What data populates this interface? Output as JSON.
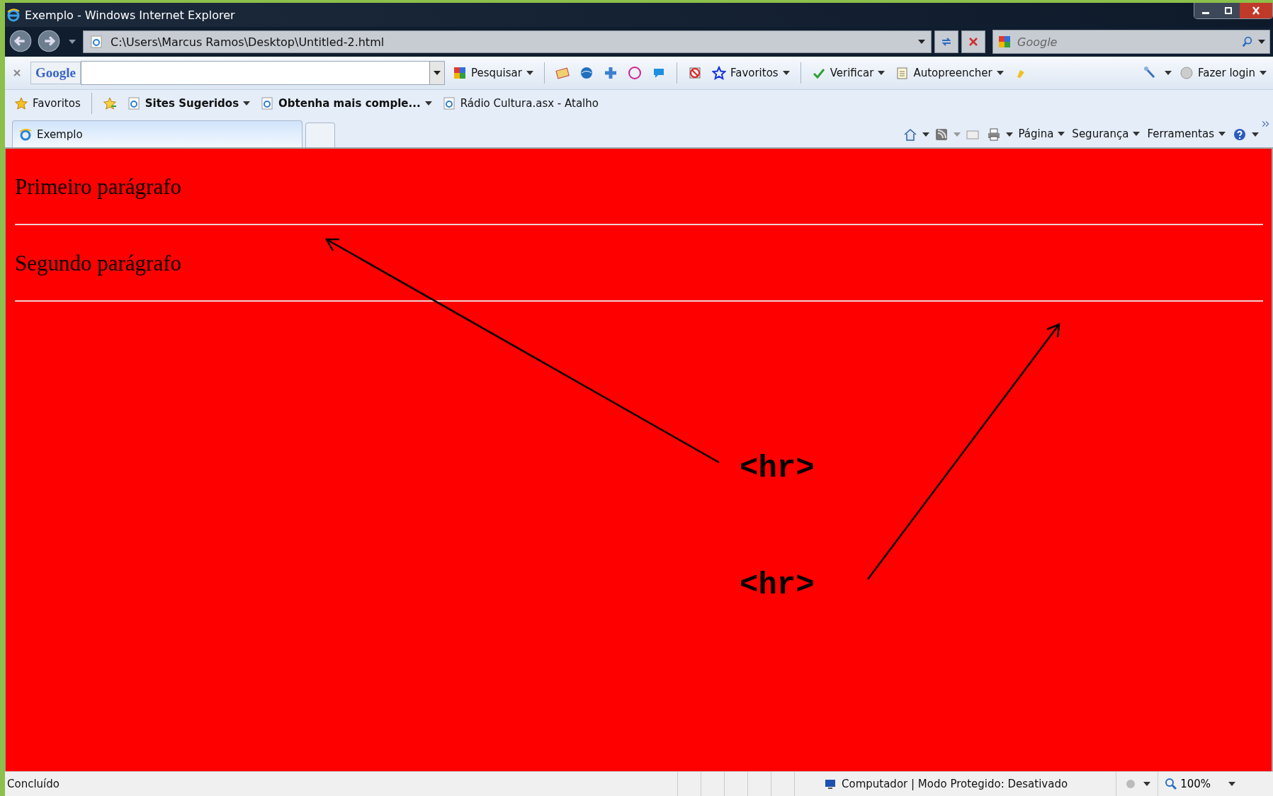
{
  "window": {
    "title": "Exemplo - Windows Internet Explorer"
  },
  "address_bar": {
    "value": "C:\\Users\\Marcus Ramos\\Desktop\\Untitled-2.html"
  },
  "search_box": {
    "placeholder": "Google"
  },
  "google_toolbar": {
    "logo": "Google",
    "search_button": "Pesquisar",
    "favorites": "Favoritos",
    "check": "Verificar",
    "autofill": "Autopreencher",
    "login": "Fazer login"
  },
  "favorites_bar": {
    "favorites": "Favoritos",
    "links": [
      {
        "label": "Sites Sugeridos",
        "bold": true,
        "dropdown": true
      },
      {
        "label": "Obtenha mais comple...",
        "bold": true,
        "dropdown": true
      },
      {
        "label": "Rádio Cultura.asx - Atalho",
        "bold": false,
        "dropdown": false
      }
    ]
  },
  "tabs": [
    {
      "label": "Exemplo",
      "selected": true
    }
  ],
  "command_bar": [
    "Página",
    "Segurança",
    "Ferramentas"
  ],
  "page": {
    "paragraphs": [
      "Primeiro parágrafo",
      "Segundo parágrafo"
    ],
    "annotations": [
      "<hr>",
      "<hr>"
    ]
  },
  "status_bar": {
    "status": "Concluído",
    "zone": "Computador | Modo Protegido: Desativado",
    "zoom": "100%"
  }
}
